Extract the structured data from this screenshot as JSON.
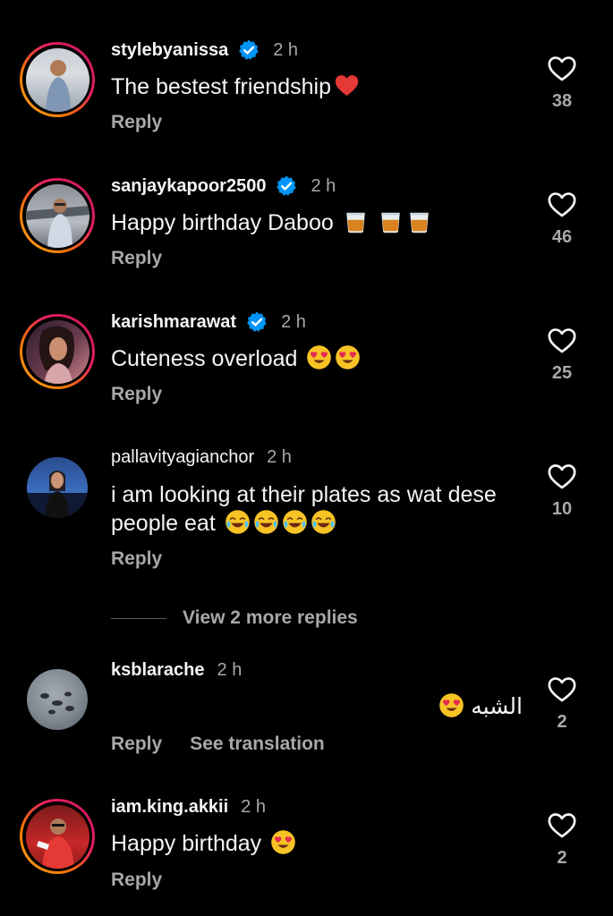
{
  "comments": [
    {
      "username": "stylebyanissa",
      "verified": true,
      "time": "2 h",
      "text": "The bestest friendship",
      "reply": "Reply",
      "likes": "38"
    },
    {
      "username": "sanjaykapoor2500",
      "verified": true,
      "time": "2 h",
      "text": "Happy birthday Daboo",
      "reply": "Reply",
      "likes": "46"
    },
    {
      "username": "karishmarawat",
      "verified": true,
      "time": "2 h",
      "text": "Cuteness overload",
      "reply": "Reply",
      "likes": "25"
    },
    {
      "username": "pallavityagianchor",
      "verified": false,
      "time": "2 h",
      "text": "i am looking at their plates as wat dese people eat",
      "reply": "Reply",
      "likes": "10"
    },
    {
      "username": "ksblarache",
      "verified": false,
      "time": "2 h",
      "text": "الشبه",
      "reply": "Reply",
      "see_translation": "See translation",
      "likes": "2"
    },
    {
      "username": "iam.king.akkii",
      "verified": false,
      "time": "2 h",
      "text": "Happy birthday",
      "reply": "Reply",
      "likes": "2"
    }
  ],
  "view_more_replies": "View 2 more replies",
  "icons": {
    "like": "heart-outline-icon",
    "verified": "verified-badge-icon"
  },
  "colors": {
    "background": "#000000",
    "text": "#f5f5f5",
    "secondary": "#a8a8a8",
    "verified": "#0095f6"
  }
}
